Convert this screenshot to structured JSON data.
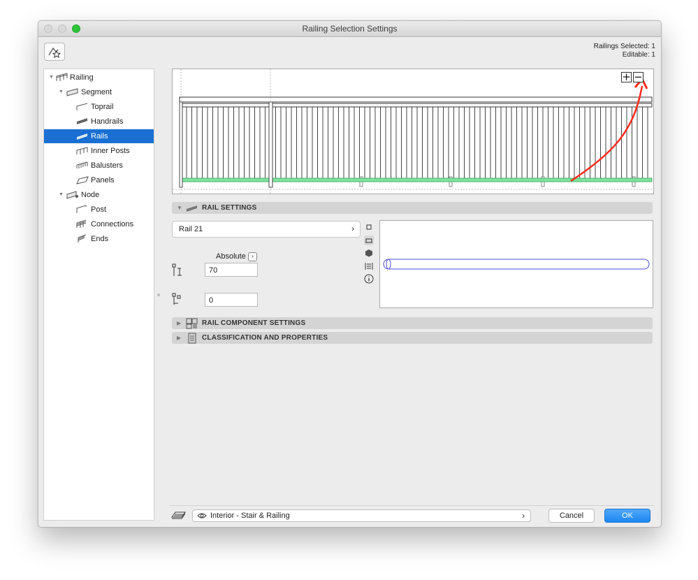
{
  "window": {
    "title": "Railing Selection Settings"
  },
  "header": {
    "selected_text": "Railings Selected: 1",
    "editable_text": "Editable: 1"
  },
  "tree": {
    "items": [
      {
        "label": "Railing",
        "icon": "railing-icon",
        "expanded": true
      },
      {
        "label": "Segment",
        "icon": "segment-icon",
        "expanded": true
      },
      {
        "label": "Toprail",
        "icon": "toprail-icon"
      },
      {
        "label": "Handrails",
        "icon": "handrails-icon"
      },
      {
        "label": "Rails",
        "icon": "rails-icon",
        "selected": true
      },
      {
        "label": "Inner Posts",
        "icon": "inner-posts-icon"
      },
      {
        "label": "Balusters",
        "icon": "balusters-icon"
      },
      {
        "label": "Panels",
        "icon": "panels-icon"
      },
      {
        "label": "Node",
        "icon": "node-icon",
        "expanded": true
      },
      {
        "label": "Post",
        "icon": "post-icon"
      },
      {
        "label": "Connections",
        "icon": "connections-icon"
      },
      {
        "label": "Ends",
        "icon": "ends-icon"
      }
    ]
  },
  "preview": {
    "zoom_in": "+",
    "zoom_out": "−",
    "highlight_color": "#7fe2a0",
    "annotation_color": "#ff2b1c"
  },
  "rail_settings": {
    "title": "RAIL SETTINGS",
    "profile_value": "Rail 21",
    "absolute_label": "Absolute",
    "height_value": "70",
    "offset_value": "0"
  },
  "sections": {
    "component_title": "RAIL COMPONENT SETTINGS",
    "classification_title": "CLASSIFICATION AND PROPERTIES"
  },
  "footer": {
    "view_value": "Interior - Stair & Railing",
    "cancel_label": "Cancel",
    "ok_label": "OK"
  }
}
